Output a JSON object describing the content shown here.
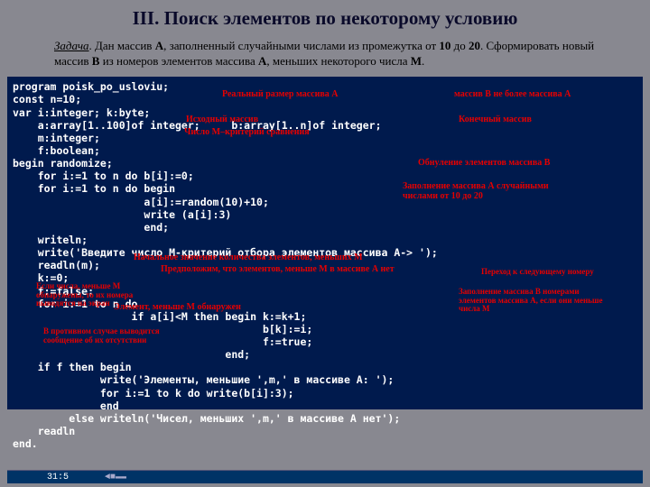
{
  "title": "III. Поиск элементов по некоторому условию",
  "task": {
    "label": "Задача",
    "text1": ". Дан массив ",
    "A": "A",
    "text2": ", заполненный случайными числами из промежутка от ",
    "n10": "10",
    "text3": " до ",
    "n20": "20",
    "text4": ". Сформировать новый массив ",
    "B": "B",
    "text5": " из номеров элементов массива ",
    "A2": "A",
    "text6": ", меньших некоторого числа ",
    "M": "M",
    "dot": "."
  },
  "code": "program poisk_po_usloviu;\nconst n=10;\nvar i:integer; k:byte;\n    a:array[1..100]of integer;     b:array[1..n]of integer;\n    m:integer;\n    f:boolean;\nbegin randomize;\n    for i:=1 to n do b[i]:=0;\n    for i:=1 to n do begin\n                     a[i]:=random(10)+10;\n                     write (a[i]:3)\n                     end;\n    writeln;\n    write('Введите число M-критерий отбора элементов массива A-> ');\n    readln(m);\n    k:=0;\n    f:=false;\n    for i:=1 to n do\n                   if a[i]<M then begin k:=k+1;\n                                        b[k]:=i;\n                                        f:=true;\n                                  end;\n    if f then begin\n              write('Элементы, меньшие ',m,' в массиве A: ');\n              for i:=1 to k do write(b[i]:3);\n              end\n         else writeln('Чисел, меньших ',m,' в массиве A нет');\n    readln\nend.",
  "ann": {
    "real_size": "Реальный размер массива А",
    "b_limit": "массив В не более массива А",
    "src_arr": "Исходный массив",
    "dst_arr": "Конечный массив",
    "m_crit": "Число М–критерий сравнения",
    "zero_b": "Обнуление элементов массива В",
    "fill_a": "Заполнение массива А случайными числами от 10 до 20",
    "k_init": "Начальное значение количества элементов, меньших М",
    "assume": "Предположим, что элементов, меньше М в массиве А нет",
    "next_i": "Переход к следующему номеру",
    "found": "Элемент, меньше М обнаружен",
    "fill_b": "Заполнение массива В номерами элементов массива А, если они меньше числа М",
    "if_found": "Если числа, меньше М обнаружены, то их номера выводятся на экран",
    "else_msg": "В противном случае выводится сообщение об их отсутствии"
  },
  "status": {
    "pos": "31:5"
  }
}
